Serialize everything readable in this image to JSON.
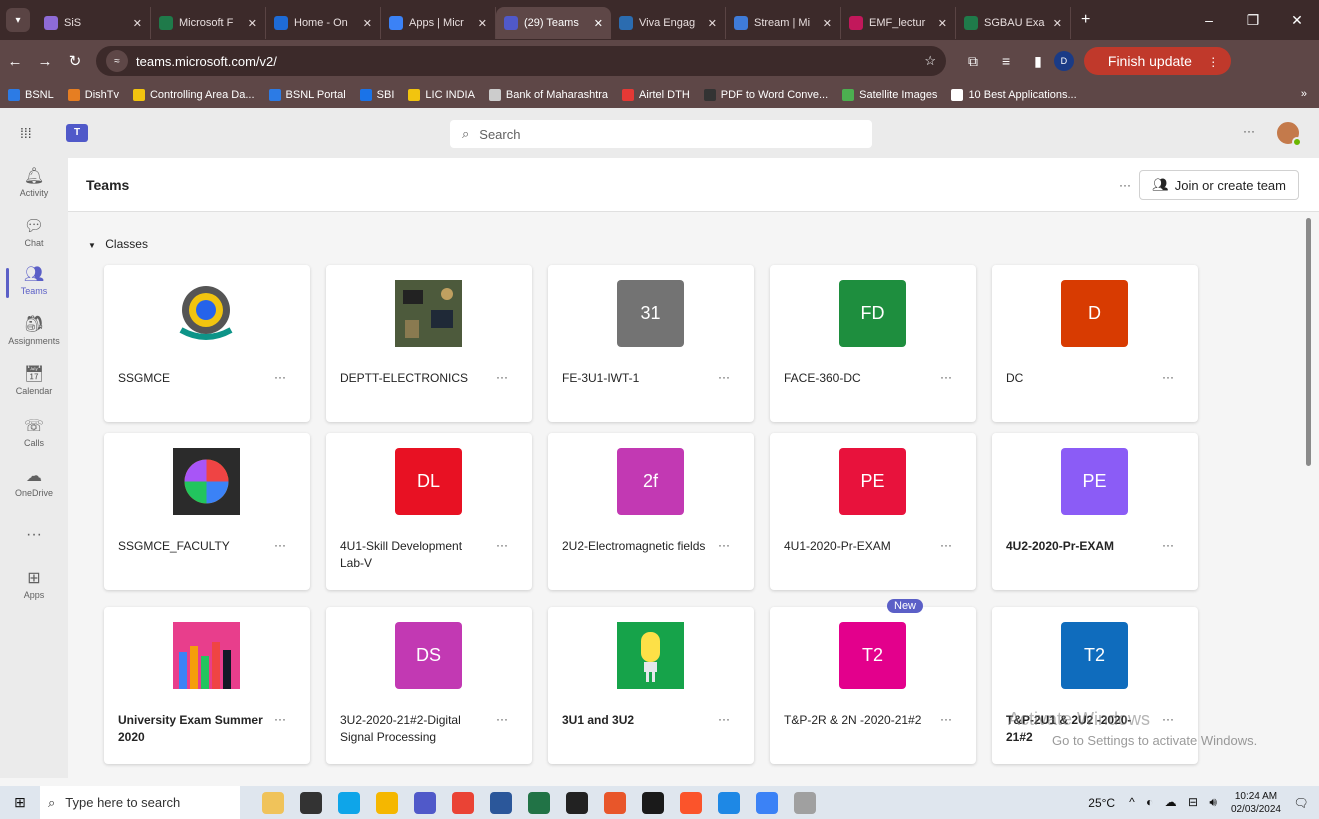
{
  "browser": {
    "tabs": [
      {
        "label": "SiS",
        "color": "#8e6bd6",
        "active": false
      },
      {
        "label": "Microsoft F",
        "color": "#1f7a4a",
        "active": false
      },
      {
        "label": "Home - On",
        "color": "#1e6bd6",
        "active": false
      },
      {
        "label": "Apps | Micr",
        "color": "#3b82f6",
        "active": false
      },
      {
        "label": "(29) Teams",
        "color": "#5059c9",
        "active": true
      },
      {
        "label": "Viva Engag",
        "color": "#2b6cb0",
        "active": false
      },
      {
        "label": "Stream | Mi",
        "color": "#3f7bd8",
        "active": false
      },
      {
        "label": "EMF_lectur",
        "color": "#c2185b",
        "active": false
      },
      {
        "label": "SGBAU Exa",
        "color": "#1f7a4a",
        "active": false
      }
    ],
    "url": "teams.microsoft.com/v2/",
    "profile_initial": "D",
    "finish_update": "Finish update",
    "bookmarks": [
      {
        "label": "BSNL",
        "color": "#2c7be5"
      },
      {
        "label": "DishTv",
        "color": "#e67e22"
      },
      {
        "label": "Controlling Area Da...",
        "color": "#f1c40f"
      },
      {
        "label": "BSNL Portal",
        "color": "#2c7be5"
      },
      {
        "label": "SBI",
        "color": "#1a73e8"
      },
      {
        "label": "LIC INDIA",
        "color": "#f1c40f"
      },
      {
        "label": "Bank of Maharashtra",
        "color": "#cccccc"
      },
      {
        "label": "Airtel DTH",
        "color": "#e53935"
      },
      {
        "label": "PDF to Word Conve...",
        "color": "#333333"
      },
      {
        "label": "Satellite Images",
        "color": "#4caf50"
      },
      {
        "label": "10 Best Applications...",
        "color": "#ffffff"
      }
    ]
  },
  "teams": {
    "search_placeholder": "Search",
    "rail": [
      {
        "label": "Activity",
        "icon": "bell-icon",
        "glyph": "🔔︎",
        "active": false
      },
      {
        "label": "Chat",
        "icon": "chat-icon",
        "glyph": "💬︎",
        "active": false
      },
      {
        "label": "Teams",
        "icon": "teams-icon",
        "glyph": "👥︎",
        "active": true
      },
      {
        "label": "Assignments",
        "icon": "assignments-icon",
        "glyph": "🎒︎",
        "active": false
      },
      {
        "label": "Calendar",
        "icon": "calendar-icon",
        "glyph": "📅︎",
        "active": false
      },
      {
        "label": "Calls",
        "icon": "phone-icon",
        "glyph": "☏",
        "active": false
      },
      {
        "label": "OneDrive",
        "icon": "cloud-icon",
        "glyph": "☁",
        "active": false
      },
      {
        "label": "",
        "icon": "more-icon",
        "glyph": "···",
        "active": false
      },
      {
        "label": "Apps",
        "icon": "apps-icon",
        "glyph": "⊞",
        "active": false
      }
    ],
    "page_title": "Teams",
    "join_label": "Join or create team",
    "section_label": "Classes",
    "cards": [
      {
        "name": "SSGMCE",
        "thumb": "",
        "color": "#ffffff",
        "bold": false,
        "image": "logo"
      },
      {
        "name": "DEPTT-ELECTRONICS",
        "thumb": "",
        "color": "#6b7b5a",
        "bold": false,
        "image": "circuit"
      },
      {
        "name": "FE-3U1-IWT-1",
        "thumb": "31",
        "color": "#737373",
        "bold": false
      },
      {
        "name": "FACE-360-DC",
        "thumb": "FD",
        "color": "#1e8e3e",
        "bold": false
      },
      {
        "name": "DC",
        "thumb": "D",
        "color": "#d83b01",
        "bold": false
      },
      {
        "name": "SSGMCE_FACULTY",
        "thumb": "",
        "color": "#2b2b2b",
        "bold": false,
        "image": "pie"
      },
      {
        "name": "4U1-Skill Development Lab-V",
        "thumb": "DL",
        "color": "#e81123",
        "bold": false
      },
      {
        "name": "2U2-Electromagnetic fields",
        "thumb": "2f",
        "color": "#c239b3",
        "bold": false
      },
      {
        "name": "4U1-2020-Pr-EXAM",
        "thumb": "PE",
        "color": "#e8123c",
        "bold": false
      },
      {
        "name": "4U2-2020-Pr-EXAM",
        "thumb": "PE",
        "color": "#8b5cf6",
        "bold": true
      },
      {
        "name": "University Exam Summer 2020",
        "thumb": "",
        "color": "#e83e8c",
        "bold": true,
        "image": "pencils"
      },
      {
        "name": "3U2-2020-21#2-Digital Signal Processing",
        "thumb": "DS",
        "color": "#c239b3",
        "bold": false
      },
      {
        "name": "3U1 and 3U2",
        "thumb": "",
        "color": "#16a34a",
        "bold": true,
        "image": "bulb"
      },
      {
        "name": "T&P-2R & 2N -2020-21#2",
        "thumb": "T2",
        "color": "#e3008c",
        "bold": false,
        "badge": "New"
      },
      {
        "name": "T&P-2U1 & 2U2 -2020-21#2",
        "thumb": "T2",
        "color": "#0f6cbd",
        "bold": true
      }
    ],
    "watermark_title": "Activate Windows",
    "watermark_sub": "Go to Settings to activate Windows."
  },
  "taskbar": {
    "search_placeholder": "Type here to search",
    "weather": "25°C",
    "time": "10:24 AM",
    "date": "02/03/2024"
  }
}
